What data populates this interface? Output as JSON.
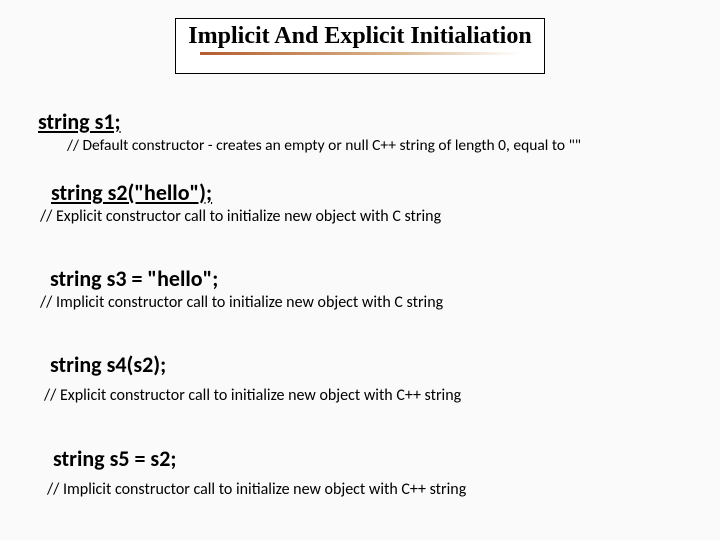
{
  "title": "Implicit And Explicit Initialiation",
  "entries": [
    {
      "code": "string s1;",
      "comment": "// Default constructor - creates an empty or null C++ string of length 0, equal to \"\""
    },
    {
      "code": "string s2(\"hello\");",
      "comment": "// Explicit constructor call to initialize new object with C string"
    },
    {
      "code": "string s3 = \"hello\";",
      "comment": "// Implicit constructor call to initialize new object with C string"
    },
    {
      "code": "string s4(s2);",
      "comment": "// Explicit constructor call to initialize new object with C++ string"
    },
    {
      "code": "string s5 = s2;",
      "comment": "// Implicit constructor call to initialize new object with C++ string"
    }
  ]
}
